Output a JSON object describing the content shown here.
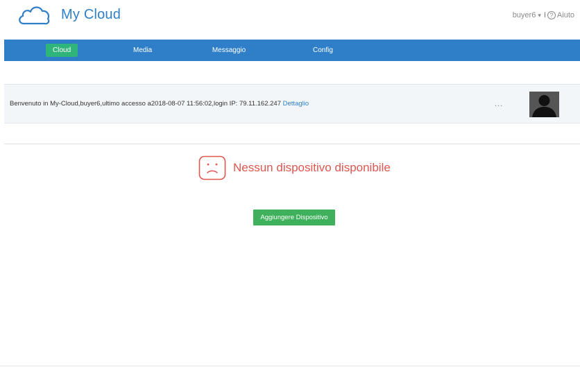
{
  "app": {
    "title": "My Cloud",
    "logo_icon": "cloud-icon"
  },
  "user": {
    "name": "buyer6",
    "caret": "▾",
    "separator": "I",
    "help_icon": "help-circle-icon",
    "help_label": "Aiuto"
  },
  "nav": {
    "items": [
      {
        "label": "Cloud",
        "active": true
      },
      {
        "label": "Media",
        "active": false
      },
      {
        "label": "Messaggio",
        "active": false
      },
      {
        "label": "Config",
        "active": false
      }
    ]
  },
  "welcome": {
    "text": "Benvenuto in My-Cloud,buyer6,ultimo accesso a2018-08-07 11:56:02,login IP:  79.11.162.247 ",
    "link": "Dettaglio",
    "more": "...",
    "avatar_icon": "user-avatar-icon"
  },
  "empty_state": {
    "icon": "sad-face-icon",
    "message": "Nessun dispositivo disponibile"
  },
  "actions": {
    "add_device": "Aggiungere Dispositivo"
  },
  "colors": {
    "brand_blue": "#2f7fc8",
    "active_green": "#2fb47c",
    "button_green": "#3fb15c",
    "error_red": "#e0554f"
  }
}
